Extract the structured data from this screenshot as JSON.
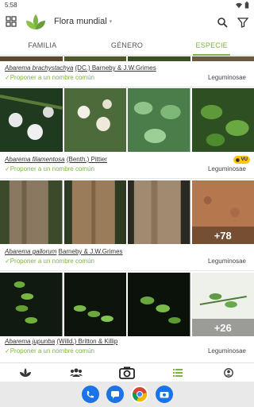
{
  "status_bar": {
    "time": "5:58"
  },
  "app": {
    "title": "Flora mundial",
    "brand_color": "#7cb342"
  },
  "tabs": [
    {
      "label": "FAMILIA",
      "active": false
    },
    {
      "label": "GÉNERO",
      "active": false
    },
    {
      "label": "ESPECIE",
      "active": true
    }
  ],
  "species": [
    {
      "genus_species": "Abarema brachystachya",
      "author": "(DC.) Barneby & J.W.Grimes",
      "propose_label": "Proponer a un nombre común",
      "family": "Leguminosae",
      "badge": "",
      "more_count": ""
    },
    {
      "genus_species": "Abarema filamentosa",
      "author": "(Benth.) Pittier",
      "propose_label": "Proponer a un nombre común",
      "family": "Leguminosae",
      "badge": "VU",
      "more_count": ""
    },
    {
      "genus_species": "Abarema gallorum",
      "author": "Barneby & J.W.Grimes",
      "propose_label": "Proponer a un nombre común",
      "family": "Leguminosae",
      "badge": "",
      "more_count": "+78"
    },
    {
      "genus_species": "Abarema jupunba",
      "author": "(Willd.) Britton & Killip",
      "propose_label": "Proponer a un nombre común",
      "family": "Leguminosae",
      "badge": "",
      "more_count": "+26"
    }
  ],
  "icons": {
    "grid": "grid-icon",
    "logo": "plant-logo-icon",
    "search": "search-icon",
    "filter": "filter-icon",
    "nav": [
      "plant-icon",
      "community-icon",
      "camera-icon",
      "list-icon",
      "profile-icon"
    ],
    "dock": [
      "phone-icon",
      "messages-icon",
      "chrome-icon",
      "camera-app-icon"
    ]
  }
}
